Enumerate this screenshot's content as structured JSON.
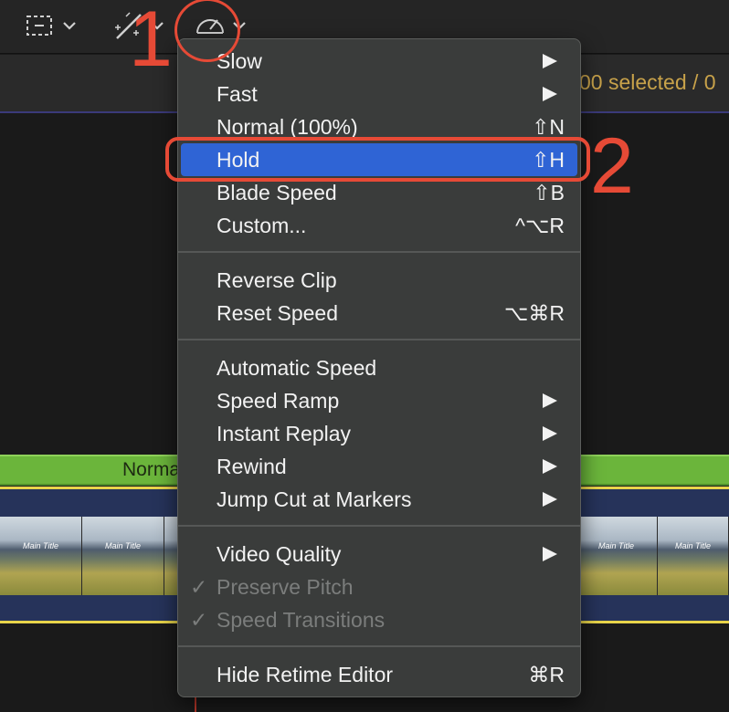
{
  "toolbar": {
    "icons": [
      "select-tool-icon",
      "effects-tool-icon",
      "retime-speedometer-icon"
    ],
    "chevron_icon": "chevron-down-icon"
  },
  "timeline": {
    "selected_text": "00 selected / 0",
    "retime_label": "Normal",
    "thumbnail_title": "Main Title"
  },
  "annotations": {
    "step1": "1",
    "step2": "2",
    "color": "#e64a36"
  },
  "menu": {
    "highlight_color": "#2f64d5",
    "groups": [
      [
        {
          "label": "Slow",
          "submenu": true
        },
        {
          "label": "Fast",
          "submenu": true
        },
        {
          "label": "Normal (100%)",
          "shortcut": "⇧N"
        },
        {
          "label": "Hold",
          "shortcut": "⇧H",
          "highlighted": true
        },
        {
          "label": "Blade Speed",
          "shortcut": "⇧B"
        },
        {
          "label": "Custom...",
          "shortcut": "^⌥R"
        }
      ],
      [
        {
          "label": "Reverse Clip"
        },
        {
          "label": "Reset Speed",
          "shortcut": "⌥⌘R"
        }
      ],
      [
        {
          "label": "Automatic Speed"
        },
        {
          "label": "Speed Ramp",
          "submenu": true
        },
        {
          "label": "Instant Replay",
          "submenu": true
        },
        {
          "label": "Rewind",
          "submenu": true
        },
        {
          "label": "Jump Cut at Markers",
          "submenu": true
        }
      ],
      [
        {
          "label": "Video Quality",
          "submenu": true
        },
        {
          "label": "Preserve Pitch",
          "checked": true,
          "disabled": true,
          "check": "✓"
        },
        {
          "label": "Speed Transitions",
          "checked": true,
          "disabled": true,
          "check": "✓"
        }
      ],
      [
        {
          "label": "Hide Retime Editor",
          "shortcut": "⌘R"
        }
      ]
    ]
  }
}
